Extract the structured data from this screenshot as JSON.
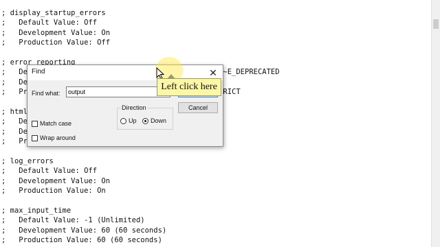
{
  "editor": {
    "lines": [
      "; display_startup_errors",
      ";   Default Value: Off",
      ";   Development Value: On",
      ";   Production Value: Off",
      "",
      "; error_reporting",
      ";   Default Value: E_ALL & ~E_NOTICE & ~E_STRICT & ~E_DEPRECATED",
      ";   Development Value: E_ALL",
      ";   Production Value: E_ALL & ~E_DEPRECATED & ~E_STRICT",
      "",
      "; html_errors",
      ";   Default Value: On",
      ";   Development Value: On",
      ";   Production value: On",
      "",
      "; log_errors",
      ";   Default Value: Off",
      ";   Development Value: On",
      ";   Production Value: On",
      "",
      "; max_input_time",
      ";   Default Value: -1 (Unlimited)",
      ";   Development Value: 60 (60 seconds)",
      ";   Production Value: 60 (60 seconds)"
    ]
  },
  "find_dialog": {
    "title": "Find",
    "close_glyph": "✕",
    "find_what_label": "Find what:",
    "find_what_value": "output",
    "find_next_label": "",
    "cancel_label": "Cancel",
    "direction_label": "Direction",
    "up_label": "Up",
    "down_label": "Down",
    "direction_selected": "Down",
    "match_case_label": "Match case",
    "wrap_around_label": "Wrap around"
  },
  "tooltip": {
    "text": "Left click here"
  },
  "colors": {
    "highlight": "#ffe63c",
    "tooltip_bg": "#fbf7a6",
    "dialog_bg": "#f0f0f0"
  }
}
